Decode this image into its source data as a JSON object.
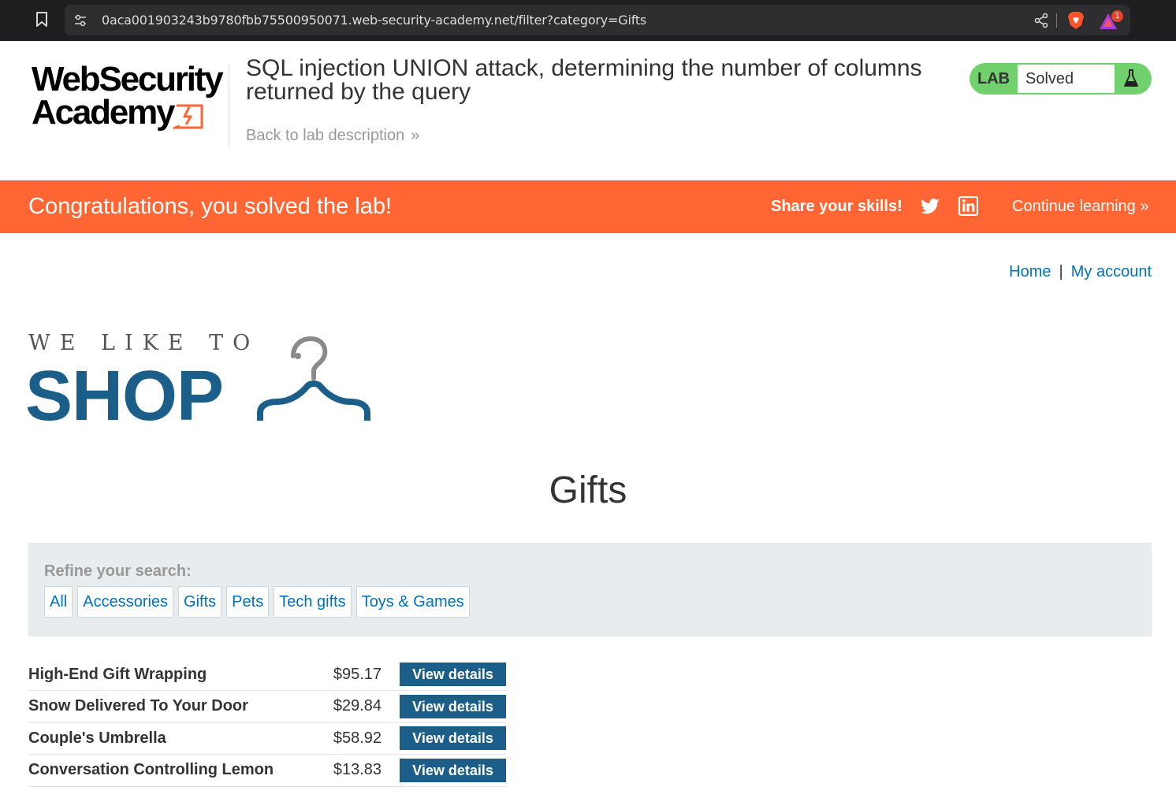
{
  "browser": {
    "url": "0aca001903243b9780fbb75500950071.web-security-academy.net/filter?category=Gifts",
    "notification_count": "1"
  },
  "lab_header": {
    "logo_line1": "WebSecurity",
    "logo_line2": "Academy",
    "title": "SQL injection UNION attack, determining the number of columns returned by the query",
    "back_link": "Back to lab description",
    "status_label": "LAB",
    "status_value": "Solved"
  },
  "banner": {
    "message": "Congratulations, you solved the lab!",
    "share_label": "Share your skills!",
    "continue_label": "Continue learning"
  },
  "top_nav": {
    "home": "Home",
    "separator": "|",
    "my_account": "My account"
  },
  "shop_logo": {
    "tagline": "WE LIKE TO",
    "word": "SHOP"
  },
  "page": {
    "heading": "Gifts"
  },
  "filter": {
    "label": "Refine your search:",
    "categories": [
      "All",
      "Accessories",
      "Gifts",
      "Pets",
      "Tech gifts",
      "Toys & Games"
    ]
  },
  "products": [
    {
      "name": "High-End Gift Wrapping",
      "price": "$95.17",
      "action": "View details"
    },
    {
      "name": "Snow Delivered To Your Door",
      "price": "$29.84",
      "action": "View details"
    },
    {
      "name": "Couple's Umbrella",
      "price": "$58.92",
      "action": "View details"
    },
    {
      "name": "Conversation Controlling Lemon",
      "price": "$13.83",
      "action": "View details"
    }
  ],
  "colors": {
    "accent_orange": "#ff6633",
    "lab_solved_green": "#70d16d",
    "link_blue": "#0071bc",
    "shop_blue": "#1b5e8a",
    "filter_bg": "#e8ecef"
  },
  "icons": {
    "bookmark": "bookmark-icon",
    "site_settings": "site-settings-icon",
    "share": "share-icon",
    "brave_shield": "brave-shield-icon",
    "brave_rewards": "brave-rewards-icon",
    "lab_flask": "flask-icon",
    "twitter": "twitter-icon",
    "linkedin": "linkedin-icon",
    "hanger": "hanger-icon"
  }
}
